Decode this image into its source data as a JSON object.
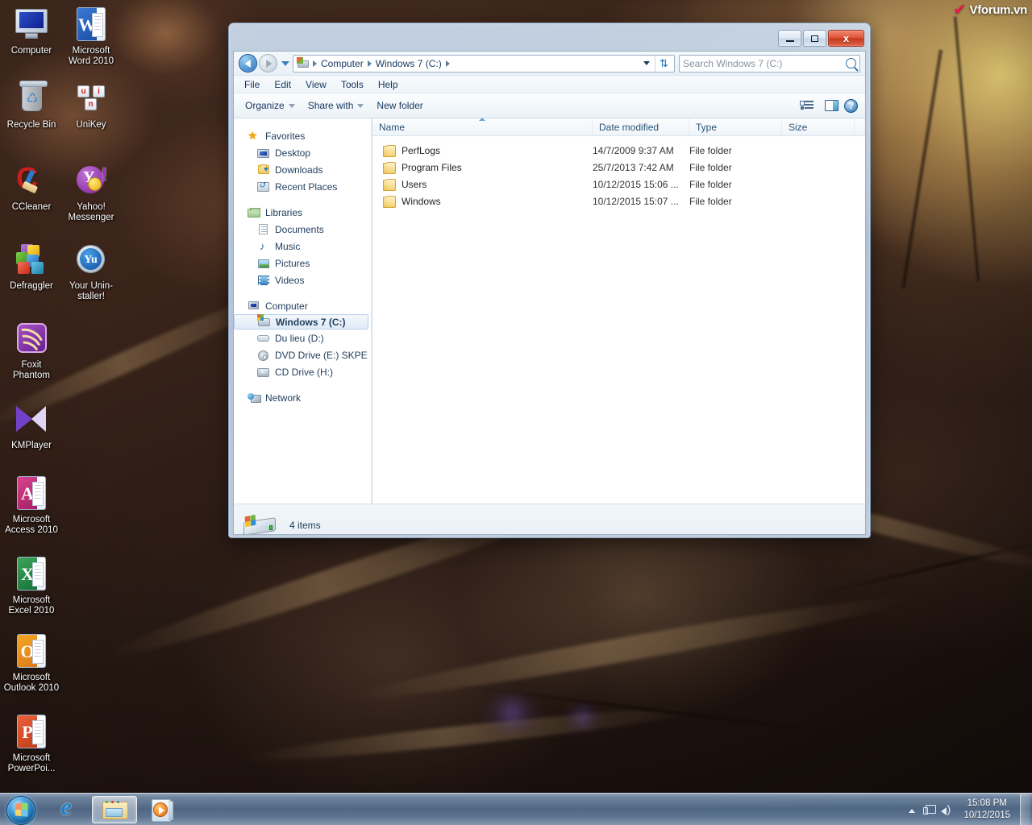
{
  "watermark": {
    "text": "Vforum.vn",
    "logo_icon": "check-icon",
    "accent_color": "#e8174a"
  },
  "desktop": {
    "icons": [
      {
        "label": "Computer",
        "icon": "computer-icon"
      },
      {
        "label": "Microsoft Word 2010",
        "icon": "word-icon"
      },
      {
        "label": "Recycle Bin",
        "icon": "recycle-bin-icon"
      },
      {
        "label": "UniKey",
        "icon": "unikey-icon"
      },
      {
        "label": "CCleaner",
        "icon": "ccleaner-icon"
      },
      {
        "label": "Yahoo! Messenger",
        "icon": "yahoo-messenger-icon"
      },
      {
        "label": "Defraggler",
        "icon": "defraggler-icon"
      },
      {
        "label": "Your Unin-staller!",
        "icon": "your-uninstaller-icon"
      },
      {
        "label": "Foxit Phantom",
        "icon": "foxit-phantom-icon"
      },
      {
        "label": "KMPlayer",
        "icon": "kmplayer-icon"
      },
      {
        "label": "Microsoft Access 2010",
        "icon": "access-icon"
      },
      {
        "label": "Microsoft Excel 2010",
        "icon": "excel-icon"
      },
      {
        "label": "Microsoft Outlook 2010",
        "icon": "outlook-icon"
      },
      {
        "label": "Microsoft PowerPoi...",
        "icon": "powerpoint-icon"
      }
    ]
  },
  "window": {
    "title": "",
    "controls": {
      "minimize": "—",
      "maximize": "□",
      "close": "x"
    },
    "nav": {
      "back_icon": "back-arrow-icon",
      "forward_icon": "forward-arrow-icon",
      "recent_icon": "chevron-down-icon"
    },
    "breadcrumb": {
      "root_icon": "drive-windows-icon",
      "items": [
        "Computer",
        "Windows 7 (C:)"
      ]
    },
    "address_dropdown_icon": "chevron-down-icon",
    "refresh_icon": "refresh-icon",
    "search": {
      "placeholder": "Search Windows 7 (C:)",
      "value": "",
      "icon": "search-icon"
    },
    "menubar": [
      "File",
      "Edit",
      "View",
      "Tools",
      "Help"
    ],
    "toolbar": {
      "organize": "Organize",
      "share_with": "Share with",
      "new_folder": "New folder",
      "change_view_icon": "change-view-icon",
      "view_dropdown_icon": "chevron-down-icon",
      "preview_pane_icon": "preview-pane-icon",
      "help_icon": "help-icon",
      "help_label": "?"
    }
  },
  "navpane": {
    "groups": [
      {
        "label": "Favorites",
        "icon": "star-icon",
        "items": [
          {
            "label": "Desktop",
            "icon": "desktop-icon"
          },
          {
            "label": "Downloads",
            "icon": "downloads-folder-icon"
          },
          {
            "label": "Recent Places",
            "icon": "recent-places-icon"
          }
        ]
      },
      {
        "label": "Libraries",
        "icon": "libraries-icon",
        "items": [
          {
            "label": "Documents",
            "icon": "documents-icon"
          },
          {
            "label": "Music",
            "icon": "music-icon"
          },
          {
            "label": "Pictures",
            "icon": "pictures-icon"
          },
          {
            "label": "Videos",
            "icon": "videos-icon"
          }
        ]
      },
      {
        "label": "Computer",
        "icon": "computer-icon",
        "items": [
          {
            "label": "Windows 7 (C:)",
            "icon": "windows-drive-icon",
            "selected": true
          },
          {
            "label": "Du lieu (D:)",
            "icon": "hard-drive-icon"
          },
          {
            "label": "DVD Drive (E:) SKPE",
            "icon": "dvd-drive-icon"
          },
          {
            "label": "CD Drive (H:)",
            "icon": "cd-drive-icon"
          }
        ]
      },
      {
        "label": "Network",
        "icon": "network-icon",
        "items": []
      }
    ]
  },
  "filelist": {
    "columns": [
      "Name",
      "Date modified",
      "Type",
      "Size"
    ],
    "sort": {
      "column": "Name",
      "direction": "ascending",
      "icon": "sort-ascending-icon"
    },
    "rows": [
      {
        "name": "PerfLogs",
        "date": "14/7/2009 9:37 AM",
        "type": "File folder",
        "size": "",
        "icon": "folder-icon"
      },
      {
        "name": "Program Files",
        "date": "25/7/2013 7:42 AM",
        "type": "File folder",
        "size": "",
        "icon": "folder-icon"
      },
      {
        "name": "Users",
        "date": "10/12/2015 15:06 ...",
        "type": "File folder",
        "size": "",
        "icon": "folder-icon"
      },
      {
        "name": "Windows",
        "date": "10/12/2015 15:07 ...",
        "type": "File folder",
        "size": "",
        "icon": "folder-icon"
      }
    ]
  },
  "statusbar": {
    "text": "4 items",
    "icon": "windows-drive-icon"
  },
  "taskbar": {
    "start_icon": "windows-start-orb-icon",
    "buttons": [
      {
        "label": "",
        "icon": "internet-explorer-icon",
        "active": false
      },
      {
        "label": "",
        "icon": "windows-explorer-icon",
        "active": true
      },
      {
        "label": "",
        "icon": "windows-media-player-icon",
        "active": false
      }
    ],
    "tray": {
      "show_hidden_icon": "chevron-up-icon",
      "network_icon": "network-icon",
      "volume_icon": "volume-icon",
      "time": "15:08 PM",
      "date": "10/12/2015",
      "show_desktop_icon": "show-desktop-button"
    }
  }
}
